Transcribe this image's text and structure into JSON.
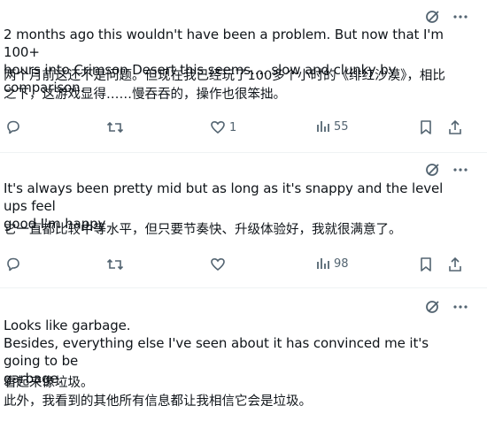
{
  "posts": [
    {
      "text_en": "2 months ago this wouldn't have been a problem. But now that I'm 100+\nhours into Crimson Desert this seems.... slow and clunky by comparison.",
      "text_zh": "两个月前这还不是问题。但现在我已经玩了100多个小时的《绯红沙漠》，相比\n之下，这游戏显得……慢吞吞的，操作也很笨拙。",
      "likes": "1",
      "views": "55"
    },
    {
      "text_en": "It's always been pretty mid but as long as it's snappy and the level ups feel\ngood I'm happy",
      "text_zh": "它一直都比较中等水平，但只要节奏快、升级体验好，我就很满意了。",
      "likes": "",
      "views": "98"
    },
    {
      "text_en": "Looks like garbage.\nBesides, everything else I've seen about it has convinced me it's going to be\ngarbage.",
      "text_zh": "看起来像垃圾。\n此外，我看到的其他所有信息都让我相信它会是垃圾。"
    }
  ],
  "icons": {
    "top": [
      "grok-icon",
      "more-icon"
    ],
    "actions": [
      "reply-icon",
      "repost-icon",
      "like-icon",
      "views-icon",
      "bookmark-icon",
      "share-icon"
    ]
  },
  "colors": {
    "icon": "#536471",
    "divider": "#eff3f4",
    "text": "#0f1419"
  }
}
